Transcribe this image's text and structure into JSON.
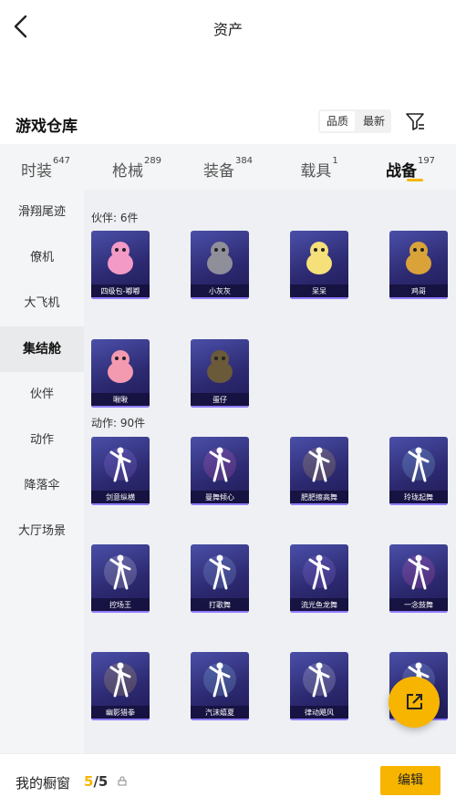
{
  "header": {
    "title": "资产",
    "back_icon": "back-arrow-icon"
  },
  "warehouse": {
    "title": "游戏仓库",
    "sort_options": [
      "品质",
      "最新"
    ],
    "active_sort": "品质",
    "filter_icon": "filter-icon"
  },
  "tabs": [
    {
      "label": "时装",
      "count": "647"
    },
    {
      "label": "枪械",
      "count": "289"
    },
    {
      "label": "装备",
      "count": "384"
    },
    {
      "label": "载具",
      "count": "1"
    },
    {
      "label": "战备",
      "count": "197",
      "active": true
    }
  ],
  "sidebar": {
    "items": [
      "滑翔尾迹",
      "僚机",
      "大飞机",
      "集结舱",
      "伙伴",
      "动作",
      "降落伞",
      "大厅场景"
    ],
    "active": "集结舱"
  },
  "content": {
    "partners_section": {
      "title": "伙伴: 6件",
      "items": [
        "四级包-嘟嘟",
        "小灰灰",
        "呆呆",
        "鸡哥",
        "啾啾",
        "蛋仔"
      ]
    },
    "actions_section": {
      "title": "动作: 90件",
      "items": [
        "剑意纵横",
        "曼舞倾心",
        "肥肥擦高舞",
        "玲珑起舞",
        "控场王",
        "打歌舞",
        "流光鱼龙舞",
        "一念鼓舞",
        "幽影猎拳",
        "汽沫嬉夏",
        "律动飓风",
        ""
      ]
    },
    "colors": {
      "card_bg": "#2d2a72",
      "accent": "#f7b500"
    }
  },
  "fab": {
    "icon": "share-out-icon"
  },
  "bottom": {
    "label": "我的橱窗",
    "count_current": "5",
    "count_total": "/5",
    "lock_icon": "lock-icon",
    "edit_label": "编辑"
  }
}
